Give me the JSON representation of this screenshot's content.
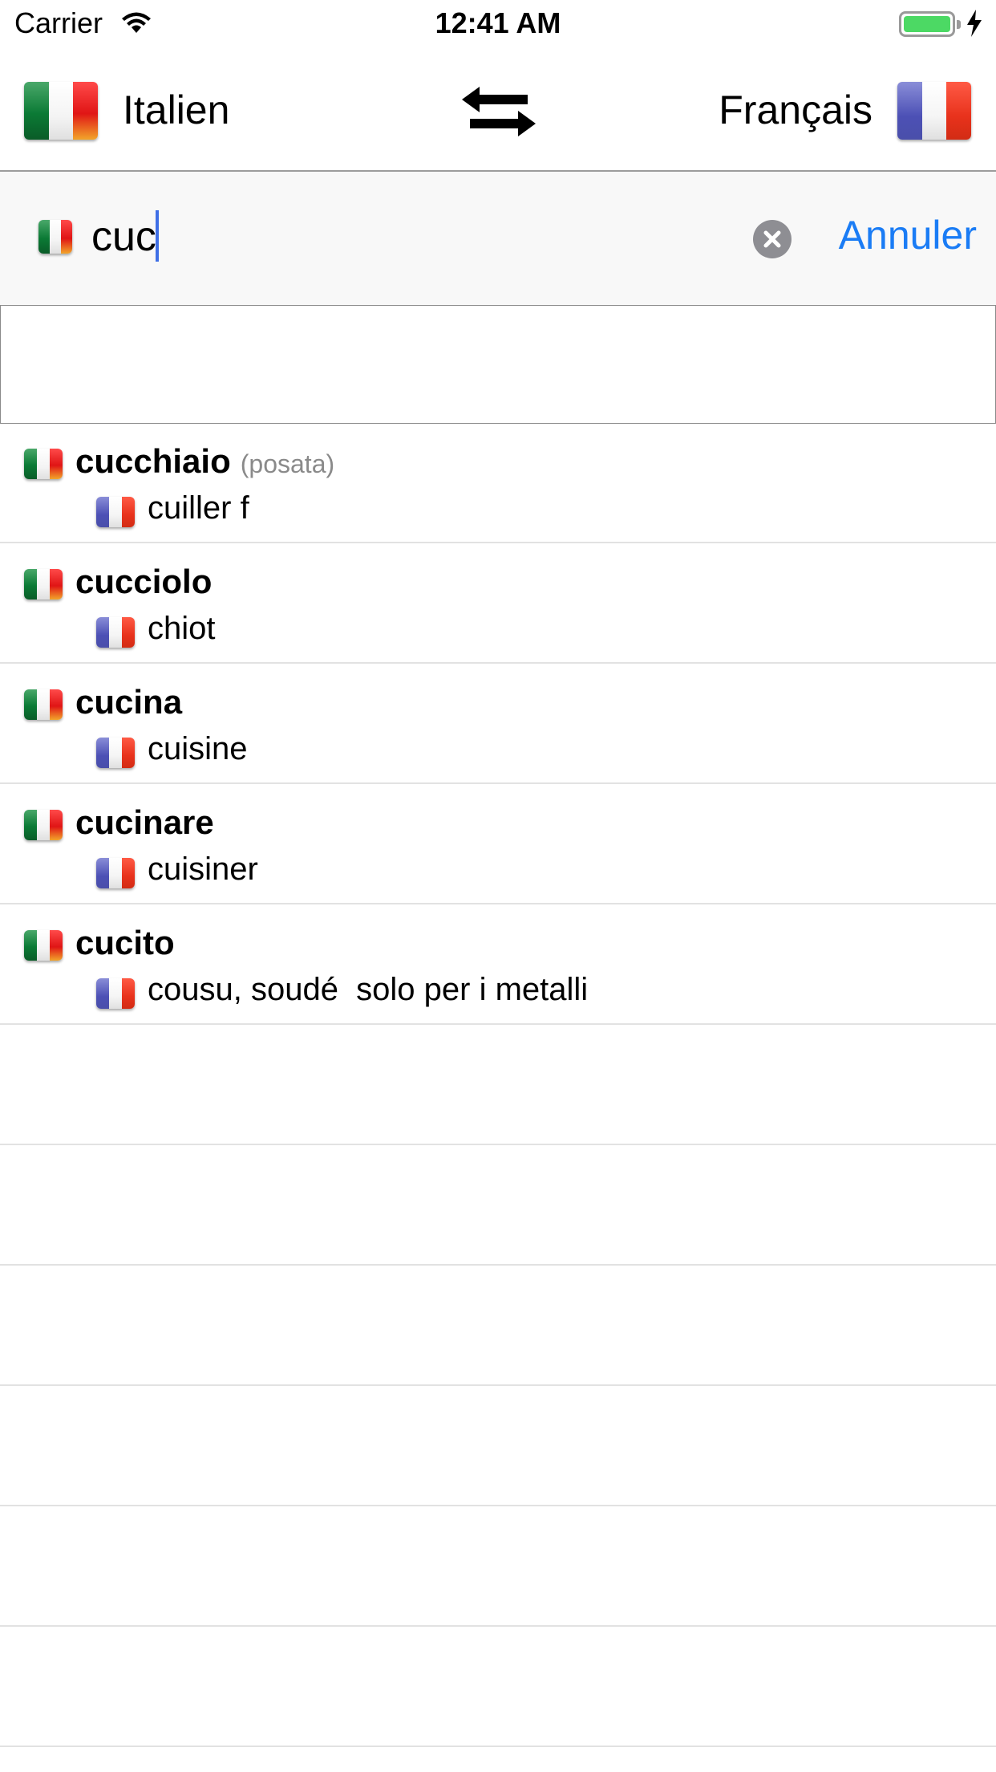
{
  "status_bar": {
    "carrier": "Carrier",
    "time": "12:41 AM"
  },
  "header": {
    "source_language": "Italien",
    "target_language": "Français",
    "swap_icon": "swap-arrows-icon"
  },
  "search": {
    "query": "cuc",
    "cancel_label": "Annuler"
  },
  "results": [
    {
      "term": "cucchiaio",
      "qualifier": "(posata)",
      "translation": "cuiller f"
    },
    {
      "term": "cucciolo",
      "qualifier": "",
      "translation": "chiot"
    },
    {
      "term": "cucina",
      "qualifier": "",
      "translation": "cuisine"
    },
    {
      "term": "cucinare",
      "qualifier": "",
      "translation": "cuisiner"
    },
    {
      "term": "cucito",
      "qualifier": "",
      "translation": "cousu, soudé  solo per i metalli"
    }
  ],
  "colors": {
    "accent": "#1a7cf5",
    "battery": "#4cd964",
    "separator": "#e2e2e2"
  }
}
